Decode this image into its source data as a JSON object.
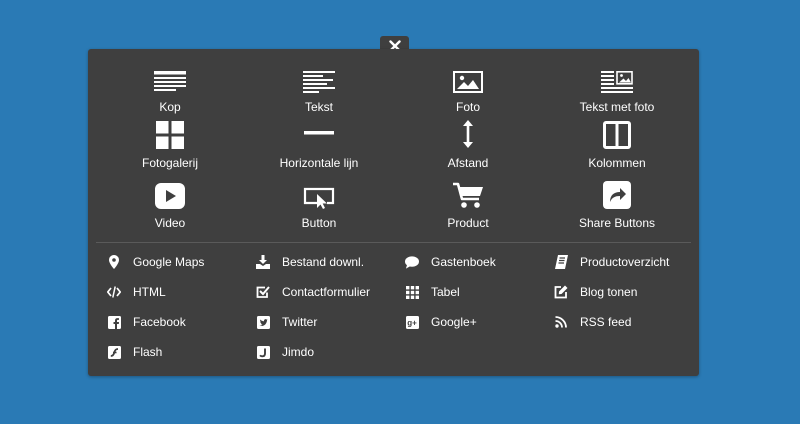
{
  "close": {
    "label": "×"
  },
  "big_items": [
    {
      "label": "Kop",
      "icon": "heading-icon"
    },
    {
      "label": "Tekst",
      "icon": "text-icon"
    },
    {
      "label": "Foto",
      "icon": "photo-icon"
    },
    {
      "label": "Tekst met foto",
      "icon": "text-with-photo-icon"
    },
    {
      "label": "Fotogalerij",
      "icon": "gallery-icon"
    },
    {
      "label": "Horizontale lijn",
      "icon": "horizontal-line-icon"
    },
    {
      "label": "Afstand",
      "icon": "spacing-icon"
    },
    {
      "label": "Kolommen",
      "icon": "columns-icon"
    },
    {
      "label": "Video",
      "icon": "video-icon"
    },
    {
      "label": "Button",
      "icon": "button-icon"
    },
    {
      "label": "Product",
      "icon": "cart-icon"
    },
    {
      "label": "Share Buttons",
      "icon": "share-icon"
    }
  ],
  "small_items": [
    {
      "label": "Google Maps",
      "icon": "map-pin-icon"
    },
    {
      "label": "Bestand downl.",
      "icon": "download-icon"
    },
    {
      "label": "Gastenboek",
      "icon": "speech-bubble-icon"
    },
    {
      "label": "Productoverzicht",
      "icon": "catalog-icon"
    },
    {
      "label": "HTML",
      "icon": "code-icon"
    },
    {
      "label": "Contactformulier",
      "icon": "checkbox-icon"
    },
    {
      "label": "Tabel",
      "icon": "table-icon"
    },
    {
      "label": "Blog tonen",
      "icon": "edit-icon"
    },
    {
      "label": "Facebook",
      "icon": "facebook-icon"
    },
    {
      "label": "Twitter",
      "icon": "twitter-icon"
    },
    {
      "label": "Google+",
      "icon": "google-plus-icon"
    },
    {
      "label": "RSS feed",
      "icon": "rss-icon"
    },
    {
      "label": "Flash",
      "icon": "flash-icon"
    },
    {
      "label": "Jimdo",
      "icon": "jimdo-icon"
    }
  ],
  "colors": {
    "background": "#2a7ab5",
    "panel": "#3f3f3f",
    "text": "#ffffff"
  }
}
